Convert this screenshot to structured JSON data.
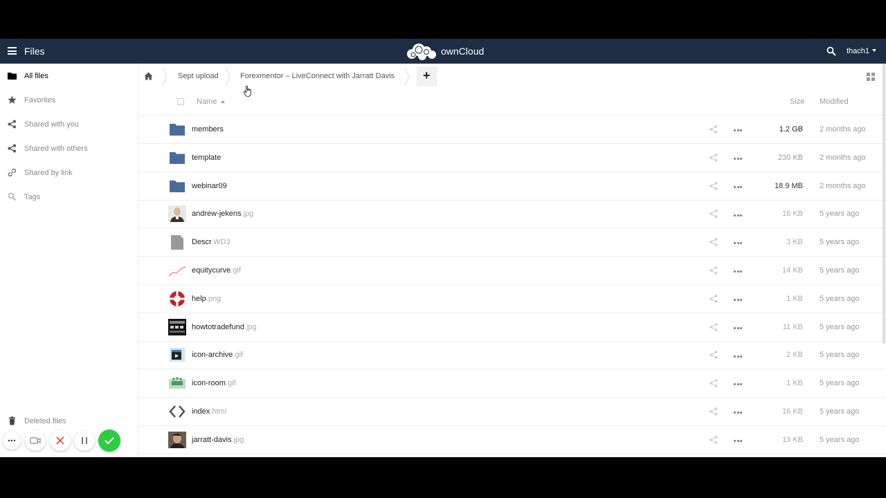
{
  "header": {
    "app_name": "Files",
    "logo_text": "ownCloud",
    "user": "thach1"
  },
  "sidebar": {
    "items": [
      {
        "label": "All files",
        "icon": "folder-icon"
      },
      {
        "label": "Favorites",
        "icon": "star-icon"
      },
      {
        "label": "Shared with you",
        "icon": "share-icon"
      },
      {
        "label": "Shared with others",
        "icon": "share-icon"
      },
      {
        "label": "Shared by link",
        "icon": "link-icon"
      },
      {
        "label": "Tags",
        "icon": "search-icon"
      }
    ],
    "deleted_files": "Deleted files"
  },
  "breadcrumb": {
    "items": [
      "Sept upload",
      "Forexmentor – LiveConnect with Jarratt Davis"
    ]
  },
  "new_button": "+",
  "table": {
    "col_name": "Name",
    "col_size": "Size",
    "col_modified": "Modified",
    "rows": [
      {
        "name": "members",
        "ext": "",
        "type": "folder",
        "size": "1.2 GB",
        "modified": "2 months ago",
        "size_color": "#222222"
      },
      {
        "name": "template",
        "ext": "",
        "type": "folder",
        "size": "230 KB",
        "modified": "2 months ago",
        "size_color": "#999999"
      },
      {
        "name": "webinar09",
        "ext": "",
        "type": "folder",
        "size": "18.9 MB",
        "modified": "2 months ago",
        "size_color": "#333333"
      },
      {
        "name": "andrew-jekens",
        "ext": ".jpg",
        "type": "photo",
        "size": "16 KB",
        "modified": "5 years ago",
        "size_color": "#aaaaaa"
      },
      {
        "name": "Descr",
        "ext": ".WD3",
        "type": "file",
        "size": "3 KB",
        "modified": "5 years ago",
        "size_color": "#aaaaaa"
      },
      {
        "name": "equitycurve",
        "ext": ".gif",
        "type": "chart",
        "size": "14 KB",
        "modified": "5 years ago",
        "size_color": "#aaaaaa"
      },
      {
        "name": "help",
        "ext": ".png",
        "type": "lifebuoy",
        "size": "1 KB",
        "modified": "5 years ago",
        "size_color": "#aaaaaa"
      },
      {
        "name": "howtotradefund",
        "ext": ".jpg",
        "type": "dark",
        "size": "11 KB",
        "modified": "5 years ago",
        "size_color": "#aaaaaa"
      },
      {
        "name": "icon-archive",
        "ext": ".gif",
        "type": "archive",
        "size": "2 KB",
        "modified": "5 years ago",
        "size_color": "#aaaaaa"
      },
      {
        "name": "icon-room",
        "ext": ".gif",
        "type": "room",
        "size": "1 KB",
        "modified": "5 years ago",
        "size_color": "#aaaaaa"
      },
      {
        "name": "index",
        "ext": ".html",
        "type": "code",
        "size": "16 KB",
        "modified": "5 years ago",
        "size_color": "#aaaaaa"
      },
      {
        "name": "jarratt-davis",
        "ext": ".jpg",
        "type": "photo2",
        "size": "13 KB",
        "modified": "5 years ago",
        "size_color": "#aaaaaa"
      }
    ]
  },
  "colors": {
    "header_bg": "#1d2d44",
    "folder": "#4a6c9b",
    "confirm_green": "#2ecc40",
    "cancel_red": "#e74c3c"
  }
}
